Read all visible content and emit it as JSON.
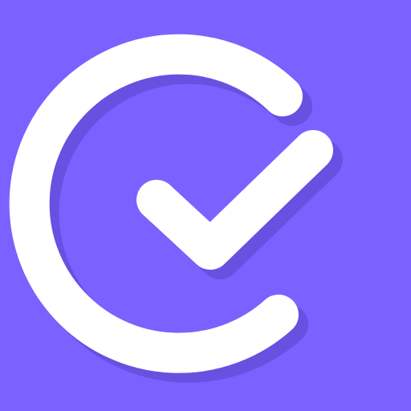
{
  "app_icon": {
    "icon_name": "check-circle-icon",
    "colors": {
      "background": "#7b61ff",
      "shadow": "#5a43c9",
      "mark": "#ffffff"
    }
  }
}
